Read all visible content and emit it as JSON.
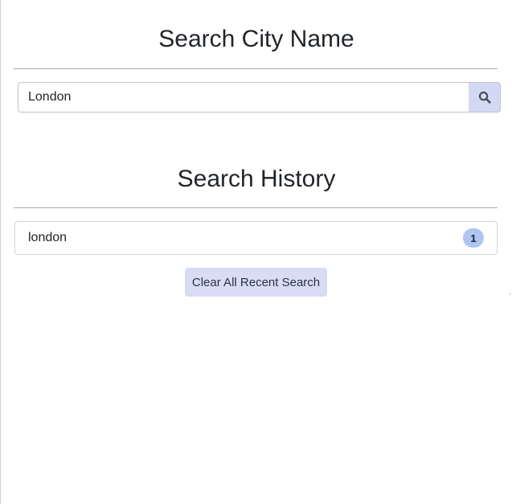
{
  "search_section": {
    "title": "Search City Name",
    "input_value": "London",
    "search_icon": "search-icon"
  },
  "history_section": {
    "title": "Search History",
    "items": [
      {
        "label": "london",
        "count": "1"
      }
    ],
    "clear_button_label": "Clear All Recent Search"
  },
  "colors": {
    "search_button_bg": "#d3d9f5",
    "badge_bg": "#aec5f2",
    "clear_button_bg": "#d8dcf5"
  }
}
